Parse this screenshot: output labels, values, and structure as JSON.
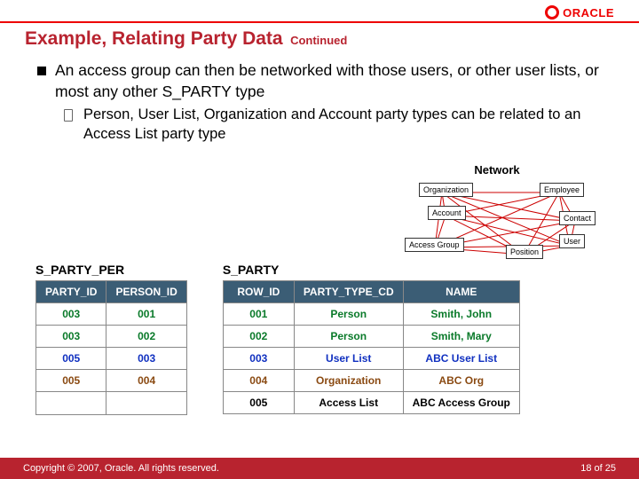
{
  "header": {
    "logo_text": "ORACLE"
  },
  "title": {
    "main": "Example, Relating Party Data",
    "cont": "Continued"
  },
  "bullet": {
    "main": "An access group can then be networked with those users, or other user lists, or most any other S_PARTY type",
    "sub": "Person, User List, Organization and Account party types can be related to an Access List party type"
  },
  "network": {
    "title": "Network",
    "nodes": [
      "Organization",
      "Employee",
      "Account",
      "Contact",
      "Access Group",
      "Position",
      "User"
    ]
  },
  "table1": {
    "title": "S_PARTY_PER",
    "headers": [
      "PARTY_ID",
      "PERSON_ID"
    ],
    "rows": [
      {
        "c": "c-green",
        "cells": [
          "003",
          "001"
        ]
      },
      {
        "c": "c-green",
        "cells": [
          "003",
          "002"
        ]
      },
      {
        "c": "c-blue",
        "cells": [
          "005",
          "003"
        ]
      },
      {
        "c": "c-brown",
        "cells": [
          "005",
          "004"
        ]
      }
    ],
    "empty_cells": [
      "",
      ""
    ]
  },
  "table2": {
    "title": "S_PARTY",
    "headers": [
      "ROW_ID",
      "PARTY_TYPE_CD",
      "NAME"
    ],
    "rows": [
      {
        "c": "c-green",
        "cells": [
          "001",
          "Person",
          "Smith, John"
        ]
      },
      {
        "c": "c-green",
        "cells": [
          "002",
          "Person",
          "Smith, Mary"
        ]
      },
      {
        "c": "c-blue",
        "cells": [
          "003",
          "User List",
          "ABC User List"
        ]
      },
      {
        "c": "c-brown",
        "cells": [
          "004",
          "Organization",
          "ABC Org"
        ]
      },
      {
        "c": "c-black",
        "cells": [
          "005",
          "Access List",
          "ABC Access Group"
        ]
      }
    ]
  },
  "footer": {
    "copyright": "Copyright © 2007, Oracle. All rights reserved.",
    "page_current": "18",
    "page_sep": " of ",
    "page_total": "25"
  }
}
